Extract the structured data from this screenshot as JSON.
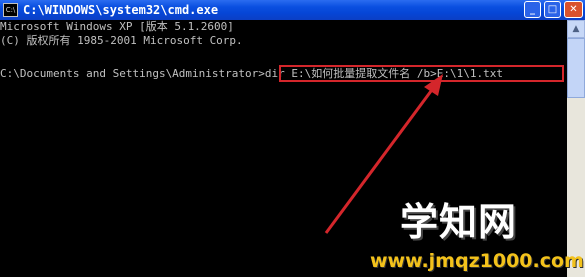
{
  "window": {
    "title": "C:\\WINDOWS\\system32\\cmd.exe",
    "icon": "cmd-icon",
    "icon_text": "C:\\",
    "buttons": {
      "minimize": "_",
      "maximize": "□",
      "close": "✕"
    }
  },
  "console": {
    "lines": [
      "Microsoft Windows XP [版本 5.1.2600]",
      "(C) 版权所有 1985-2001 Microsoft Corp.",
      "C:\\Documents and Settings\\Administrator>"
    ],
    "command": "dir E:\\如何批量提取文件名 /b>E:\\1\\1.txt"
  },
  "scrollbar": {
    "up_arrow": "▲"
  },
  "annotation": {
    "highlight_color": "#d4262b"
  },
  "watermark": {
    "logo": "学知网",
    "url": "www.jmqz1000.com"
  }
}
